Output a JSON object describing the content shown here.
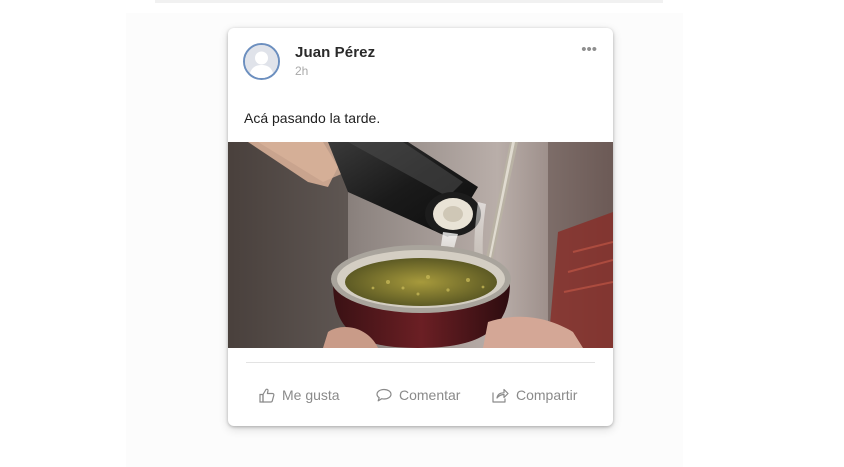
{
  "post": {
    "author": "Juan Pérez",
    "time": "2h",
    "more_icon": "•••",
    "text": "Acá pasando la tarde.",
    "image_alt": "mate-photo"
  },
  "actions": {
    "like_label": "Me gusta",
    "comment_label": "Comentar",
    "share_label": "Compartir"
  },
  "colors": {
    "avatar_border": "#6c8fbf",
    "action_text": "#8a8a8a",
    "secondary_text": "#a9a9a9"
  }
}
